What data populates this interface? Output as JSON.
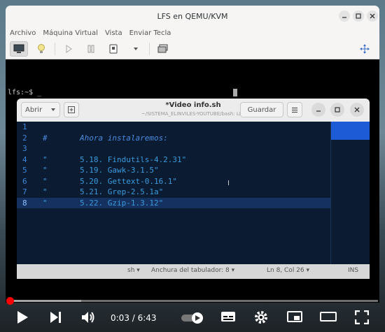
{
  "qemu": {
    "title": "LFS en QEMU/KVM",
    "menu": [
      "Archivo",
      "Máquina Virtual",
      "Vista",
      "Enviar Tecla"
    ],
    "toolbar_icons": [
      "monitor-icon",
      "bulb-icon",
      "play-icon",
      "pause-icon",
      "power-icon",
      "chevron-down-icon",
      "screenshot-icon",
      "move-icon"
    ]
  },
  "vm": {
    "prompt": "lfs:~$ _"
  },
  "gedit": {
    "open_label": "Abrir",
    "title": "*Video info.sh",
    "path": "~/SISTEMA_ELINVILES-YOUTUBE/bash: LFS",
    "save_label": "Guardar",
    "lines": [
      {
        "n": "1",
        "text": "",
        "current": false
      },
      {
        "n": "2",
        "text": "#       Ahora instalaremos:",
        "current": false
      },
      {
        "n": "3",
        "text": "",
        "current": false
      },
      {
        "n": "4",
        "text": "\"       5.18. Findutils-4.2.31\"",
        "current": false
      },
      {
        "n": "5",
        "text": "\"       5.19. Gawk-3.1.5\"",
        "current": false
      },
      {
        "n": "6",
        "text": "\"       5.20. Gettext-0.16.1\"",
        "current": false
      },
      {
        "n": "7",
        "text": "\"       5.21. Grep-2.5.1a\"",
        "current": false
      },
      {
        "n": "8",
        "text": "\"       5.22. Gzip-1.3.12\"",
        "current": true
      }
    ],
    "status": {
      "language": "sh",
      "tab_width": "Anchura del tabulador: 8",
      "position": "Ln 8, Col 26",
      "mode": "INS"
    }
  },
  "player": {
    "time": "0:03 / 6:43",
    "progress": 0.0075,
    "buffered": 0.2
  }
}
